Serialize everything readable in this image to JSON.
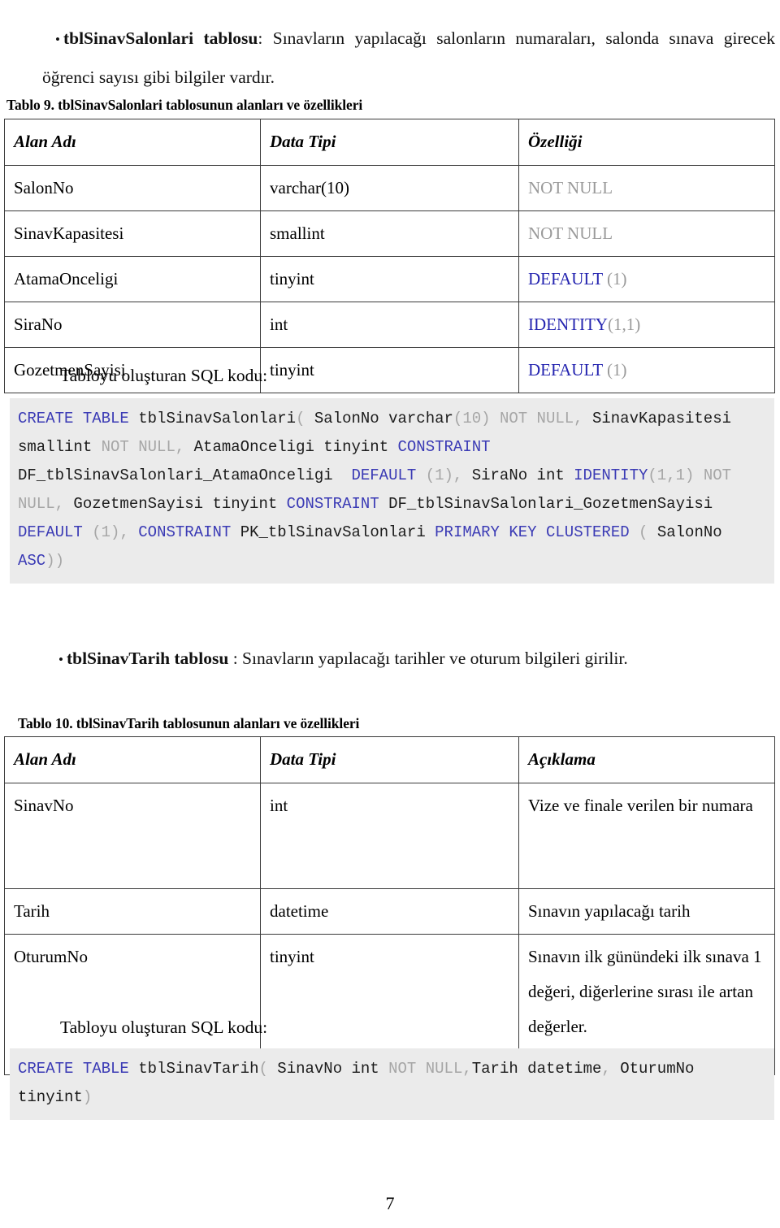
{
  "intro_sections": [
    {
      "bullet": "•",
      "table_name": "tblSinavSalonlari tablosu",
      "separator": ": ",
      "description": "Sınavların yapılacağı salonların numaraları, salonda sınava girecek öğrenci sayısı gibi bilgiler vardır."
    },
    {
      "bullet": "•",
      "table_name": "tblSinavTarih tablosu",
      "separator": " :  ",
      "description": "Sınavların yapılacağı tarihler ve oturum bilgileri girilir."
    }
  ],
  "table_9": {
    "caption": "Tablo 9. tblSinavSalonlari tablosunun alanları ve özellikleri",
    "headers": [
      "Alan Adı",
      "Data Tipi",
      "Özelliği"
    ],
    "rows": [
      {
        "field": "SalonNo",
        "type": "varchar(10)",
        "prop_kw": "NOT NULL",
        "prop_kw_style": "gray",
        "prop_arg": ""
      },
      {
        "field": "SinavKapasitesi",
        "type": "smallint",
        "prop_kw": "NOT NULL",
        "prop_kw_style": "gray",
        "prop_arg": ""
      },
      {
        "field": "AtamaOnceligi",
        "type": "tinyint",
        "prop_kw": "DEFAULT",
        "prop_kw_style": "blue",
        "prop_arg": " (1)"
      },
      {
        "field": "SiraNo",
        "type": "int",
        "prop_kw": "IDENTITY",
        "prop_kw_style": "blue",
        "prop_arg": "(1,1)"
      },
      {
        "field": "GozetmenSayisi",
        "type": "tinyint",
        "prop_kw": "DEFAULT",
        "prop_kw_style": "blue",
        "prop_arg": " (1)"
      }
    ]
  },
  "table_10": {
    "caption": "Tablo 10. tblSinavTarih tablosunun alanları ve özellikleri",
    "headers": [
      "Alan Adı",
      "Data Tipi",
      "Açıklama"
    ],
    "rows": [
      {
        "field": "SinavNo",
        "type": "int",
        "desc": "Vize ve finale verilen bir numara"
      },
      {
        "field": "Tarih",
        "type": "datetime",
        "desc": "Sınavın yapılacağı tarih"
      },
      {
        "field": "OturumNo",
        "type": "tinyint",
        "desc": "Sınavın ilk günündeki ilk sınava 1 değeri, diğerlerine sırası ile artan değerler."
      }
    ]
  },
  "sql_heading": "Tabloyu oluşturan SQL kodu:",
  "sql_code_1": "CREATE TABLE tblSinavSalonlari( SalonNo varchar(10) NOT NULL, SinavKapasitesi smallint NOT NULL, AtamaOnceligi tinyint CONSTRAINT DF_tblSinavSalonlari_AtamaOnceligi  DEFAULT (1), SiraNo int IDENTITY(1,1) NOT NULL, GozetmenSayisi tinyint CONSTRAINT DF_tblSinavSalonlari_GozetmenSayisi DEFAULT (1), CONSTRAINT PK_tblSinavSalonlari PRIMARY KEY CLUSTERED ( SalonNo ASC))",
  "sql_code_2": "CREATE TABLE tblSinavTarih( SinavNo int NOT NULL,Tarih datetime, OturumNo tinyint)",
  "colors": {
    "keyword_blue": "#3b3bb5",
    "dim_gray": "#a6a6a6",
    "code_background": "#ebebeb",
    "table_border": "#3a3a3a"
  },
  "page_number": "7"
}
